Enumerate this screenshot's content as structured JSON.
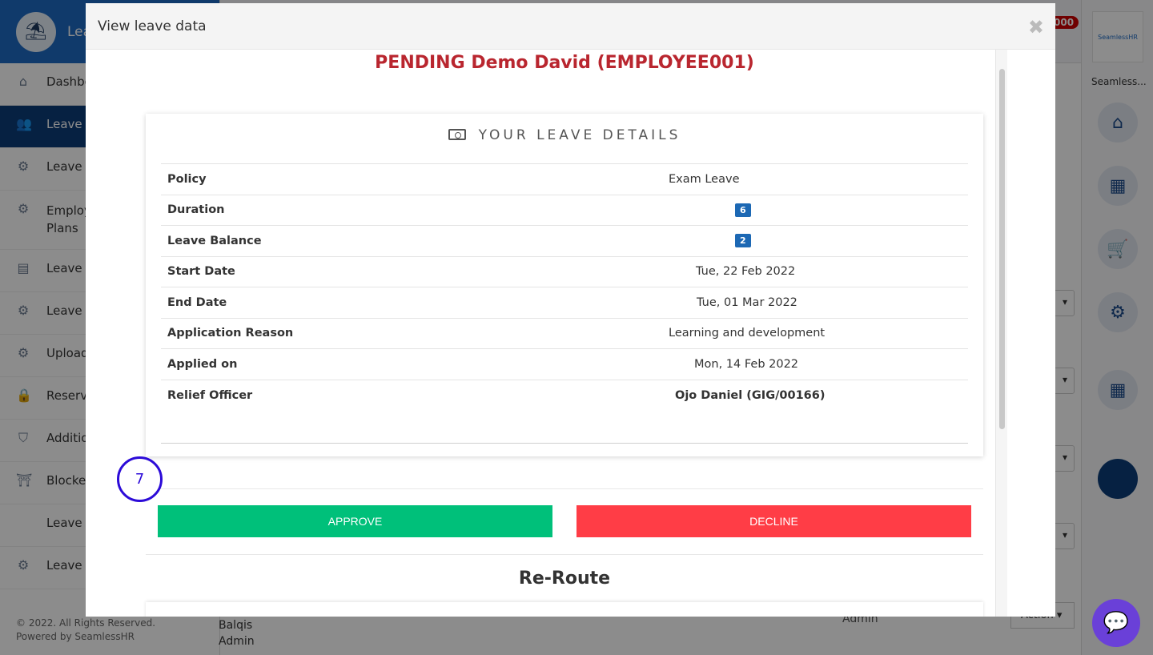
{
  "app": {
    "title": "Lea",
    "notification_count": "000",
    "sidebar": [
      {
        "label": "Dashbo",
        "icon": "home-icon"
      },
      {
        "label": "Leave F",
        "icon": "people-icon"
      },
      {
        "label": "Leave F",
        "icon": "gear-icon"
      },
      {
        "label": "Employ Plans",
        "icon": "gear-icon"
      },
      {
        "label": "Leave F",
        "icon": "clipboard-icon"
      },
      {
        "label": "Leave F",
        "icon": "gear-icon"
      },
      {
        "label": "Upload",
        "icon": "gear-icon"
      },
      {
        "label": "Reserve",
        "icon": "lock-icon"
      },
      {
        "label": "Additio",
        "icon": "shield-icon"
      },
      {
        "label": "Blocke",
        "icon": "torii-icon"
      },
      {
        "label": "Leave A",
        "icon": ""
      },
      {
        "label": "Leave S",
        "icon": "gear-icon"
      }
    ],
    "footer_line1": "© 2022. All Rights Reserved.",
    "footer_line2": "Powered by SeamlessHR",
    "table_text_1": "Balqis",
    "table_text_2": "Admin",
    "table_admin": "Admin",
    "table_action": "Action",
    "rail_brand": "SeamlessHR",
    "rail_label": "Seamless..."
  },
  "modal": {
    "title": "View leave data",
    "status_heading": "PENDING Demo David (EMPLOYEE001)",
    "card_title": "YOUR LEAVE DETAILS",
    "details": [
      {
        "label": "Policy",
        "value": "Exam Leave"
      },
      {
        "label": "Duration",
        "value": "6"
      },
      {
        "label": "Leave Balance",
        "value": "2"
      },
      {
        "label": "Start Date",
        "value": "Tue, 22 Feb 2022"
      },
      {
        "label": "End Date",
        "value": "Tue, 01 Mar 2022"
      },
      {
        "label": "Application Reason",
        "value": "Learning and development"
      },
      {
        "label": "Applied on",
        "value": "Mon, 14 Feb 2022"
      },
      {
        "label": "Relief Officer",
        "value": "Ojo Daniel (GIG/00166)"
      }
    ],
    "approve_label": "APPROVE",
    "decline_label": "DECLINE",
    "reroute_heading": "Re-Route"
  },
  "step_marker": "7",
  "colors": {
    "pending_red": "#b9262f",
    "approve_green": "#00c07a",
    "decline_red": "#ff3d46",
    "badge_blue": "#1c68b4",
    "sidebar_active": "#0c3d78"
  }
}
